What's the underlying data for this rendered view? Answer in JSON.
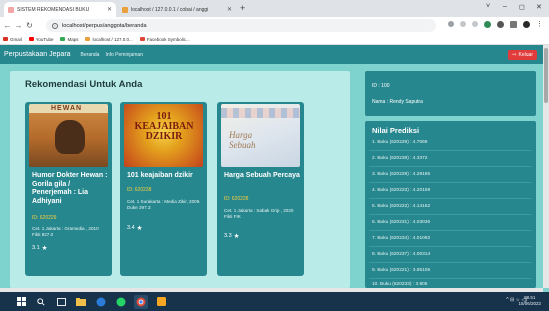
{
  "browser": {
    "tabs": [
      {
        "title": "SISTEM REKOMENDASI BUKU",
        "active": true
      },
      {
        "title": "localhost / 127.0.0.1 / cobai / anggi",
        "active": false
      }
    ],
    "new_tab": "+",
    "window_controls": [
      "˅",
      "–",
      "◻",
      "✕"
    ],
    "address": "localhost/perpus/anggota/beranda",
    "bookmarks": [
      "Gmail",
      "YouTube",
      "Maps",
      "localhost / 127.0.0...",
      "Facebook Symbolic..."
    ]
  },
  "navbar": {
    "brand": "Perpustakaan Jepara",
    "links": [
      "Beranda",
      "Info Peminjaman"
    ],
    "logout_label": "Keluar",
    "logout_icon": "⇨"
  },
  "main": {
    "section_title": "Rekomendasi Untuk Anda",
    "books": [
      {
        "title": "Humor Dokter Hewan : Gorila gila / Penerjemah : Lia Adhiyani",
        "id": "ID: 620229",
        "publisher": "Cet. 1 Jakarta : Gramedia , 2010 Fikti 827.0",
        "rating": "3.1",
        "cover_text": "HEWAN"
      },
      {
        "title": "101 keajaiban dzikir",
        "id": "ID: 620238",
        "publisher": "Cet. 1 Surakarta : Media Zikir, 2009. Duke 297.3",
        "rating": "3.4",
        "cover_text": "101 KEAJAIBAN DZIKIR"
      },
      {
        "title": "Harga Sebuah Percaya",
        "id": "ID: 620228",
        "publisher": "Cet. 1 Jakarta : Sabak Grip , 2020 Fikti FIK",
        "rating": "3.3",
        "cover_text": "Harga Sebuah"
      }
    ]
  },
  "sidebar": {
    "user_id": "ID : 100",
    "user_name": "Nama : Rendy Saputra",
    "predictions_title": "Nilai Prediksi",
    "predictions": [
      "1. Buku (620229) : 4.7069",
      "2. Buku (620238) : 4.3372",
      "3. Buku (620228) : 4.28185",
      "4. Buku (620223) : 4.20159",
      "5. Buku (620222) : 4.14152",
      "6. Buku (620231) : 4.03036",
      "7. Buku (620234) : 4.01092",
      "8. Buku (620237) : 4.00314",
      "9. Buku (620221) : 3.95105",
      "10. Buku (620233) : 3.805"
    ]
  },
  "taskbar": {
    "tray": "^ ⊟ ☼ ◁)",
    "time": "08.51",
    "date": "15/06/2022"
  },
  "colors": {
    "page_bg": "#7ed3cf",
    "navbar": "#27878f",
    "card": "#27878f",
    "id_text": "#f5cf3b",
    "logout": "#e23b3b"
  }
}
